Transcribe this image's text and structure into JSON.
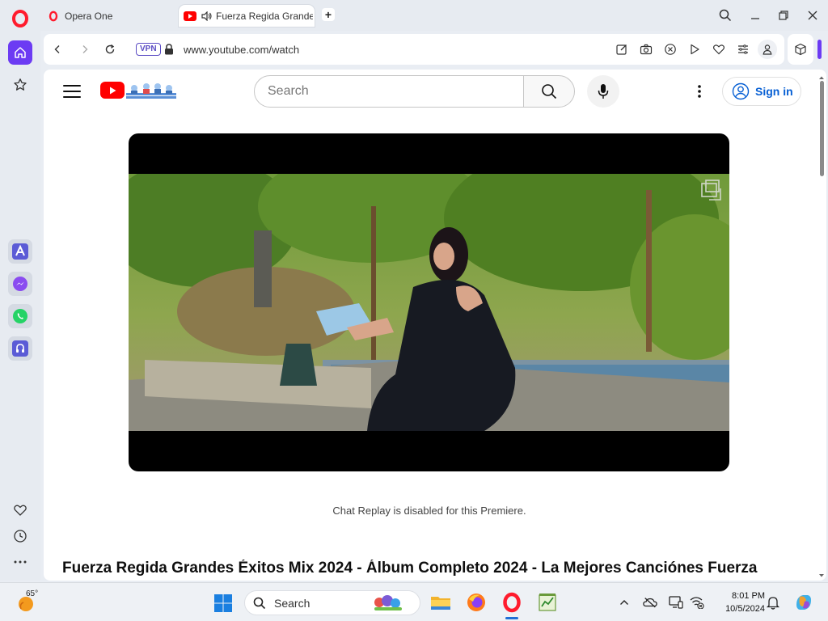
{
  "browser": {
    "tabs": [
      {
        "label": "Opera One",
        "icon": "opera-icon",
        "active": false
      },
      {
        "label": "Fuerza Regida Grandes",
        "icon": "youtube-icon",
        "active": true,
        "audio": true
      }
    ],
    "address": {
      "vpn_label": "VPN",
      "url": "www.youtube.com/watch"
    },
    "colors": {
      "accent": "#6c3bf3",
      "opera_red": "#ff1b2d"
    }
  },
  "youtube": {
    "search_placeholder": "Search",
    "signin_label": "Sign in",
    "chat_note": "Chat Replay is disabled for this Premiere.",
    "video_title": "Fuerza Regida Grandes Éxitos Mix 2024 - Álbum Completo 2024 - La Mejores Canciónes Fuerza",
    "colors": {
      "brand": "#ff0000",
      "link": "#065fd4"
    }
  },
  "taskbar": {
    "weather_temp": "65°",
    "search_label": "Search",
    "clock_time": "8:01 PM",
    "clock_date": "10/5/2024"
  }
}
